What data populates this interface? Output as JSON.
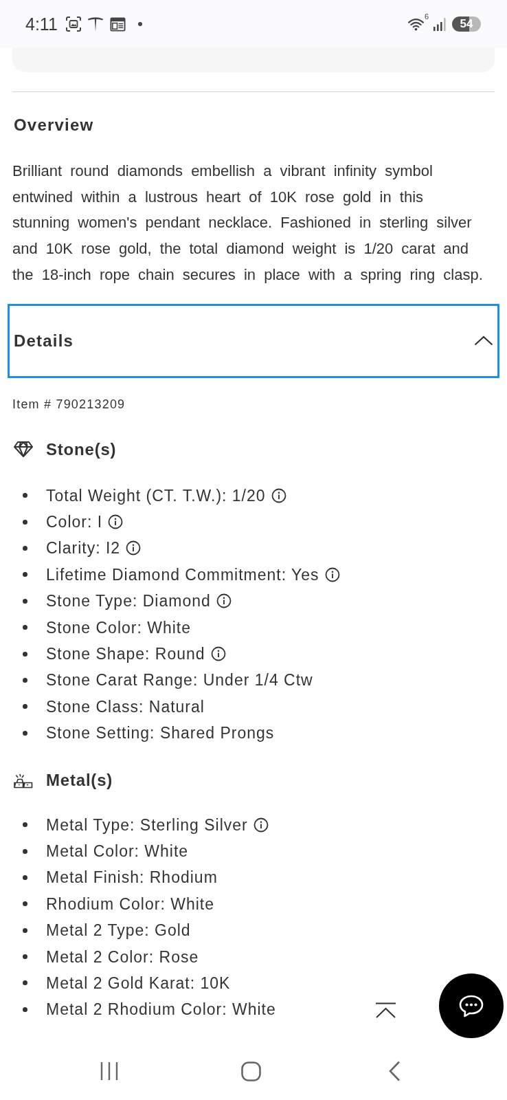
{
  "status_bar": {
    "time": "4:11",
    "wifi_label": "6",
    "battery": "54"
  },
  "overview": {
    "title": "Overview",
    "text": "Brilliant round diamonds embellish a vibrant infinity symbol entwined within a lustrous heart of 10K rose gold in this stunning women's pendant necklace. Fashioned in sterling silver and 10K rose gold, the total diamond weight is 1/20 carat and the 18-inch rope chain secures in place with a spring ring clasp."
  },
  "details": {
    "title": "Details",
    "expanded": true,
    "focused": true,
    "item_number": "Item # 790213209",
    "sections": [
      {
        "kind": "stone",
        "title": "Stone(s)",
        "items": [
          {
            "text": "Total Weight (CT. T.W.): 1/20",
            "info": true
          },
          {
            "text": "Color: I",
            "info": true
          },
          {
            "text": "Clarity: I2",
            "info": true
          },
          {
            "text": "Lifetime Diamond Commitment: Yes",
            "info": true
          },
          {
            "text": "Stone Type: Diamond",
            "info": true
          },
          {
            "text": "Stone Color: White",
            "info": false
          },
          {
            "text": "Stone Shape: Round",
            "info": true
          },
          {
            "text": "Stone Carat Range: Under 1/4 Ctw",
            "info": false
          },
          {
            "text": "Stone Class: Natural",
            "info": false
          },
          {
            "text": "Stone Setting: Shared Prongs",
            "info": false
          }
        ]
      },
      {
        "kind": "metal",
        "title": "Metal(s)",
        "items": [
          {
            "text": "Metal Type: Sterling Silver",
            "info": true
          },
          {
            "text": "Metal Color: White",
            "info": false
          },
          {
            "text": "Metal Finish: Rhodium",
            "info": false
          },
          {
            "text": "Rhodium Color: White",
            "info": false
          },
          {
            "text": "Metal 2 Type: Gold",
            "info": false
          },
          {
            "text": "Metal 2 Color: Rose",
            "info": false
          },
          {
            "text": "Metal 2 Gold Karat: 10K",
            "info": false
          },
          {
            "text": "Metal 2 Rhodium Color: White",
            "info": false
          }
        ]
      }
    ]
  }
}
